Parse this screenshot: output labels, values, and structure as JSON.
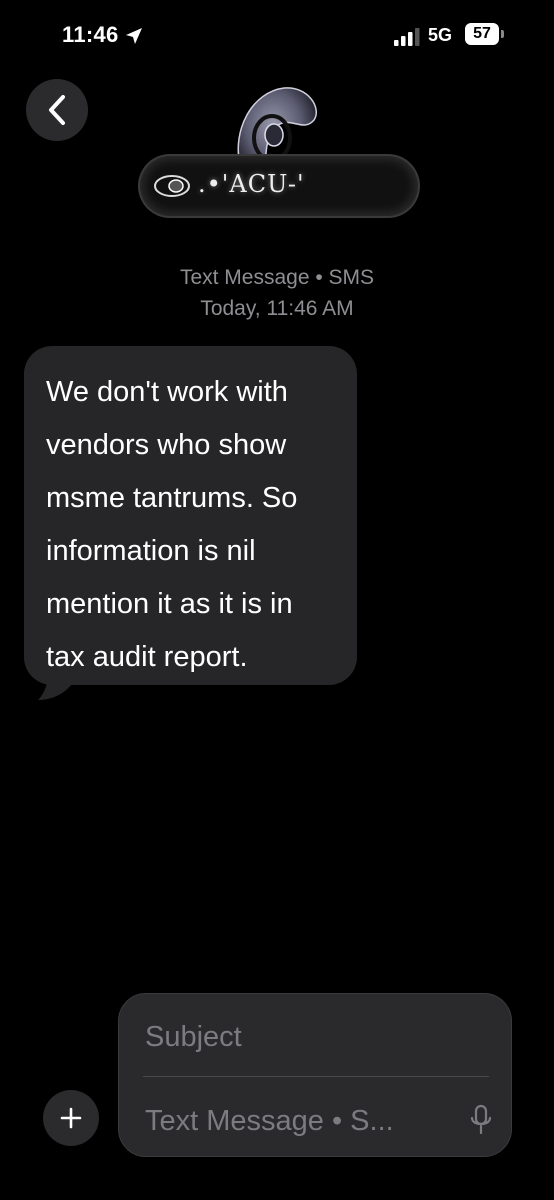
{
  "status_bar": {
    "time": "11:46",
    "network": "5G",
    "battery": "57",
    "icons": [
      "location-arrow-icon",
      "signal-bars-icon",
      "battery-icon"
    ]
  },
  "header": {
    "contact_name": ".•'ACU-'",
    "icons": [
      "back-chevron-icon",
      "contact-avatar-icon"
    ]
  },
  "meta": {
    "service": "Text Message • SMS",
    "timestamp": "Today, 11:46 AM"
  },
  "messages": [
    {
      "direction": "incoming",
      "text": "We don't work with\nvendors who show\nmsme tantrums. So\ninformation is nil\nmention it as it is in\ntax audit report."
    }
  ],
  "composer": {
    "subject_placeholder": "Subject",
    "message_placeholder": "Text Message • S...",
    "icons": [
      "plus-icon",
      "microphone-icon"
    ]
  },
  "colors": {
    "background": "#000000",
    "bubble": "#262628",
    "secondary_text": "#8e8e93",
    "composer": "#2a2a2c"
  }
}
